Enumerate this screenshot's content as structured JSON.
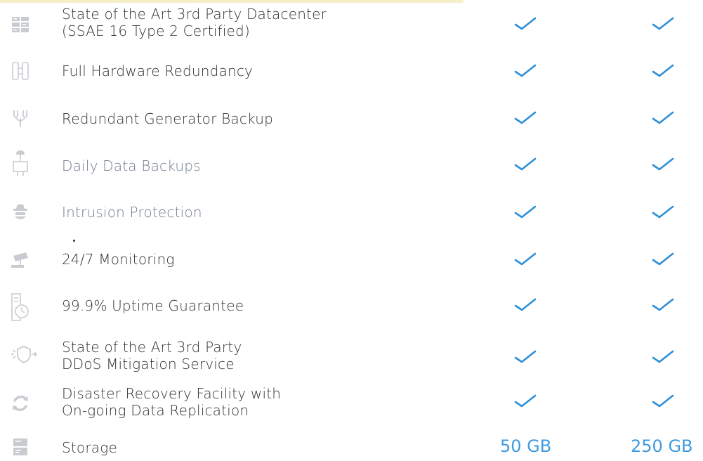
{
  "colors": {
    "check": "#2d8fd8",
    "storage_value": "#3f9ae0",
    "label_text": "#2e3136",
    "label_faded": "#6f7c8c",
    "icon_grey": "#c8ccd1",
    "top_strip": "#f5efc9"
  },
  "features": [
    {
      "icon": "datacenter-icon",
      "label_lines": [
        "State of the Art 3rd Party Datacenter",
        "(SSAE 16 Type 2 Certified)"
      ],
      "plan_a": "check",
      "plan_b": "check"
    },
    {
      "icon": "hardware-redundancy-icon",
      "label_lines": [
        "Full Hardware Redundancy"
      ],
      "plan_a": "check",
      "plan_b": "check"
    },
    {
      "icon": "generator-icon",
      "label_lines": [
        "Redundant Generator Backup"
      ],
      "plan_a": "check",
      "plan_b": "check"
    },
    {
      "icon": "cloud-backup-icon",
      "label_lines": [
        "Daily Data Backups"
      ],
      "plan_a": "check",
      "plan_b": "check"
    },
    {
      "icon": "intruder-icon",
      "label_lines": [
        "Intrusion Protection"
      ],
      "plan_a": "check",
      "plan_b": "check"
    },
    {
      "icon": "security-camera-icon",
      "label_lines": [
        "24/7 Monitoring"
      ],
      "plan_a": "check",
      "plan_b": "check"
    },
    {
      "icon": "uptime-icon",
      "label_lines": [
        "99.9% Uptime Guarantee"
      ],
      "plan_a": "check",
      "plan_b": "check"
    },
    {
      "icon": "ddos-shield-icon",
      "label_lines": [
        "State of the Art 3rd Party",
        "DDoS Mitigation Service"
      ],
      "plan_a": "check",
      "plan_b": "check"
    },
    {
      "icon": "recovery-cycle-icon",
      "label_lines": [
        "Disaster Recovery Facility with",
        "On-going Data Replication"
      ],
      "plan_a": "check",
      "plan_b": "check"
    }
  ],
  "storage": {
    "icon": "storage-drive-icon",
    "label": "Storage",
    "plan_a_value": "50 GB",
    "plan_b_value": "250 GB"
  }
}
